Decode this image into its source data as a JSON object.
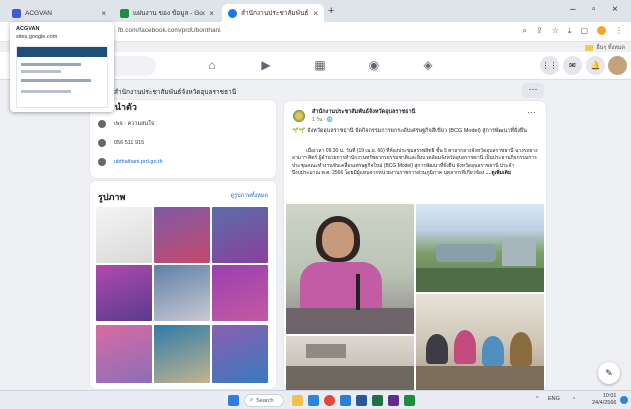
{
  "tabs": [
    {
      "title": "ACGVAN",
      "favicon_color": "#3b5bdb",
      "active": false
    },
    {
      "title": "แผ่นงาน ของ ข้อมูล - Google Drive",
      "favicon_color": "#1e8e3e",
      "active": false
    },
    {
      "title": "สำนักงานประชาสัมพันธ์จังหวัดอุบลฯ",
      "favicon_color": "#1877f2",
      "active": true
    }
  ],
  "address": {
    "url": "fb.com/facebook.com/prdUbonthani",
    "bookmark_label": "อื่นๆ ทั้งหมด"
  },
  "popover": {
    "title": "ACGVAN",
    "url": "sites.google.com"
  },
  "page": {
    "name_small": "สำนักงานประชาสัมพันธ์จังหวัดอุบลราชธานี",
    "more_label": "···"
  },
  "intro": {
    "title": "แนะนำตัว",
    "rows": [
      {
        "icon": "info-icon",
        "text": "เพจ · ความสนใจ"
      },
      {
        "icon": "phone-icon",
        "text": "056 511 915"
      },
      {
        "icon": "globe-icon",
        "text": "ubthaihani.prd.go.th"
      }
    ]
  },
  "photos": {
    "title": "รูปภาพ",
    "see_all": "ดูรูปภาพทั้งหมด"
  },
  "post": {
    "author": "สำนักงานประชาสัมพันธ์จังหวัดอุบลราชธานี",
    "time": "1 วัน · 🌐",
    "headline": "🌱🌱 จังหวัดอุบลราชธานี จัดกิจกรรมการยกระดับเศรษฐกิจสีเขียว (BCG Model) สู่การพัฒนาที่ยั่งยืน",
    "body": "เมื่อเวลา 09.30 น. วันที่ (19 เม.ย. 66) ที่ห้องประชุมสรรพสิทธิ ชั้น 5 ศาลากลางจังหวัดอุบลราชธานี นางรถยาง อามาฯ ศิตร์ ผู้อำนวยการสำนักงานทรัพยากรธรรมชาติและสิ่งแวดล้อมจังหวัดอุบลราชธานี เป็นประธานกิจกรรมการประชุมคณะทำงานขับเคลื่อนเศรษฐกิจใหม่ (BCG Model) สู่การพัฒนาที่ยั่งยืน จังหวัดอุบลราชธานี ประจำปีงบประมาณ พ.ศ. 2566 โดยมีผู้แทนจากหน่วยงานราชการส่วนภูมิภาค บุคลากรที่เกี่ยวข้อง",
    "see_more": "... ดูเพิ่มเติม"
  },
  "taskbar": {
    "search_label": "Search",
    "lang": "ENG",
    "time": "10:01",
    "date": "24/4/2566"
  },
  "colors": {
    "fb_blue": "#1877f2",
    "nav_bg": "#ffffff",
    "page_bg": "#eef0f3",
    "taskbar_bg": "#e9edf3"
  }
}
